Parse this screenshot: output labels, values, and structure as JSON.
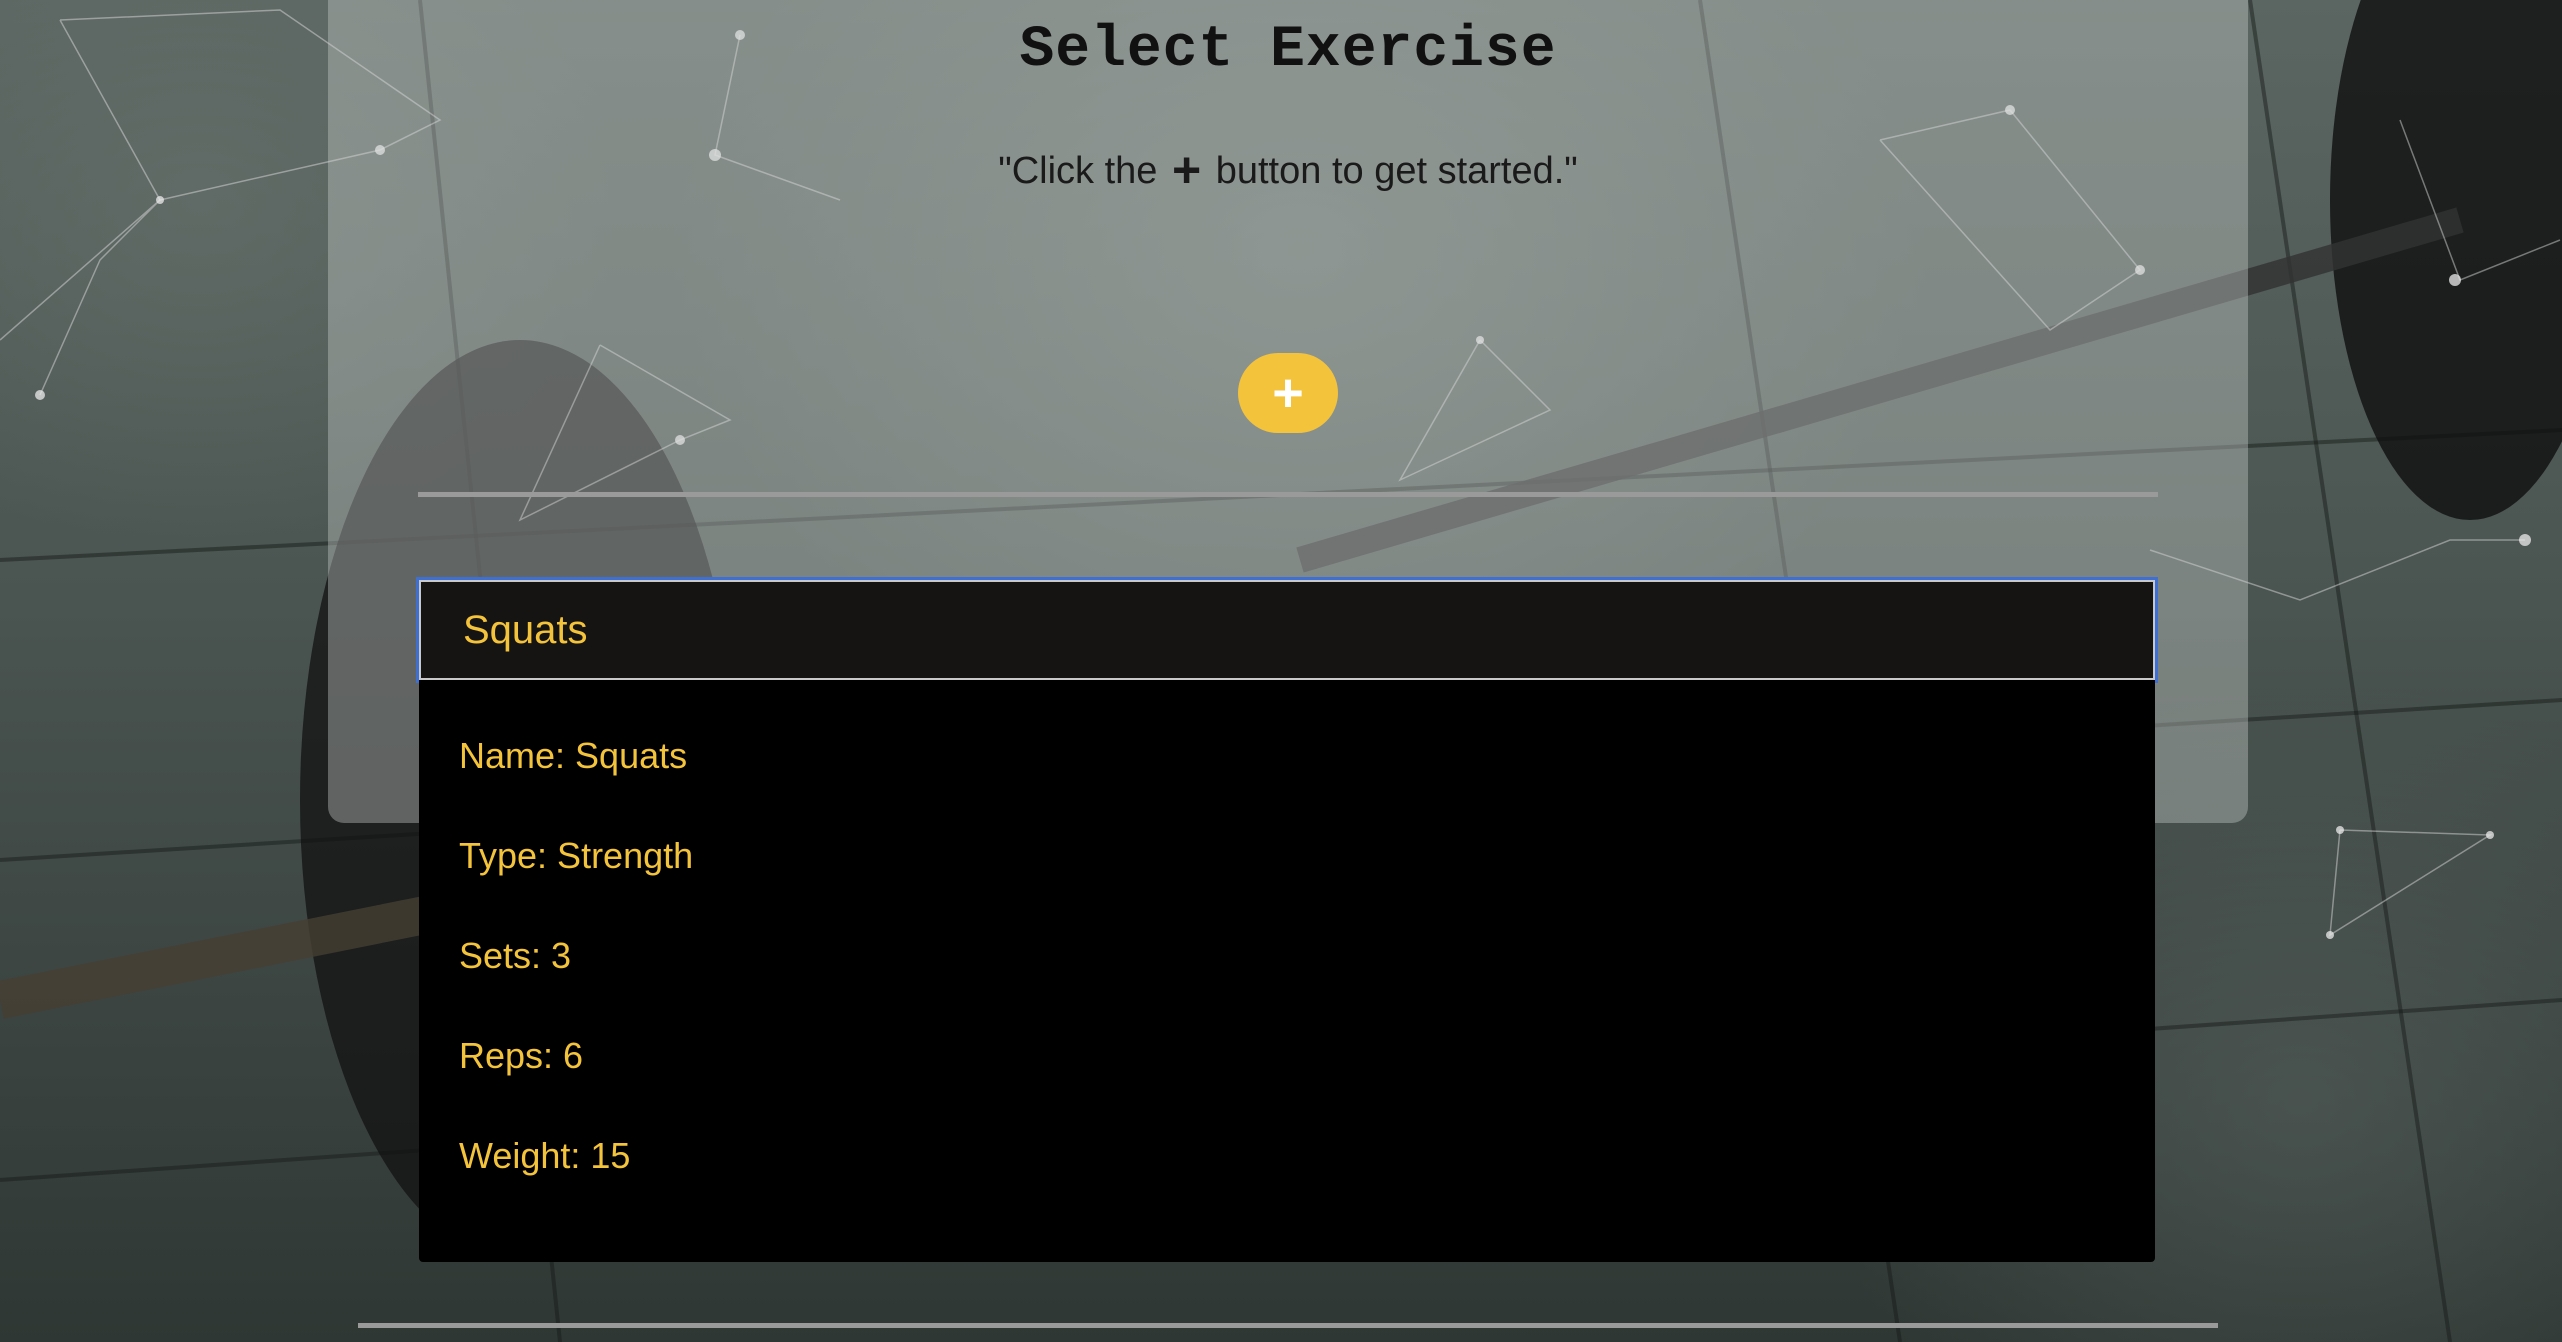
{
  "page": {
    "title": "Select Exercise",
    "hint_prefix": "\"Click the",
    "hint_icon": "plus-icon",
    "hint_suffix": "button to get started.\"",
    "add_button_label": "+"
  },
  "exercise": {
    "header": "Squats",
    "details": [
      "Name: Squats",
      "Type: Strength",
      "Sets: 3",
      "Reps: 6",
      "Weight: 15"
    ]
  },
  "colors": {
    "accent": "#f4c33c",
    "card_background": "#000000",
    "focus_outline": "#3f6fd0"
  }
}
